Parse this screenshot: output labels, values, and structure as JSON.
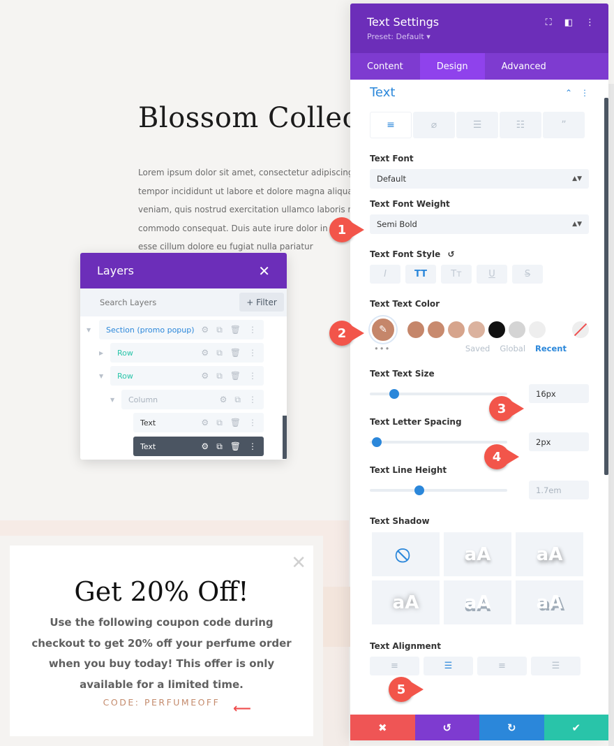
{
  "page": {
    "title": "Blossom Collect",
    "body_lines": [
      "Lorem ipsum dolor sit amet, consectetur adipiscing",
      "tempor incididunt ut labore et dolore magna aliqua",
      "veniam, quis nostrud exercitation ullamco laboris n",
      "commodo consequat. Duis aute irure dolor in",
      "esse cillum dolore eu fugiat nulla pariatur"
    ]
  },
  "layers": {
    "title": "Layers",
    "close_icon": "close-icon",
    "search_placeholder": "Search Layers",
    "filter_label": "+ Filter",
    "items": [
      {
        "label": "Section (promo popup)",
        "type": "section",
        "color": "#2b87da"
      },
      {
        "label": "Row",
        "type": "row",
        "color": "#29c4a9"
      },
      {
        "label": "Row",
        "type": "row",
        "color": "#29c4a9"
      },
      {
        "label": "Column",
        "type": "column",
        "color": "#a8b2bd"
      },
      {
        "label": "Text",
        "type": "module",
        "color": "#333333"
      },
      {
        "label": "Text",
        "type": "module",
        "color": "#ffffff",
        "selected": true
      }
    ]
  },
  "popup": {
    "title": "Get 20% Off!",
    "body": "Use the following coupon code during checkout to get 20% off your perfume order when you buy today! This offer is only available for a limited time.",
    "code": "CODE: PERFUMEOFF",
    "code_color": "#c48b6d"
  },
  "settings": {
    "title": "Text Settings",
    "preset": "Preset: Default ▾",
    "tabs": [
      "Content",
      "Design",
      "Advanced"
    ],
    "active_tab": "Design",
    "section_title": "Text",
    "text_font_label": "Text Font",
    "text_font_value": "Default",
    "font_weight_label": "Text Font Weight",
    "font_weight_value": "Semi Bold",
    "font_style_label": "Text Font Style",
    "font_style_buttons": [
      "I",
      "TT",
      "Tт",
      "U",
      "S"
    ],
    "font_style_active": "TT",
    "text_color_label": "Text Text Color",
    "text_color_value": "#c5866a",
    "swatches": [
      "#c5866a",
      "#c88a6e",
      "#d6a48c",
      "#dbb29e",
      "#111111",
      "#d4d4d4",
      "#eeeeee"
    ],
    "swatch_tabs": [
      "Saved",
      "Global",
      "Recent"
    ],
    "swatch_tab_active": "Recent",
    "more_dots": "•••",
    "text_size_label": "Text Text Size",
    "text_size_value": "16px",
    "text_size_fraction": 0.18,
    "letter_spacing_label": "Text Letter Spacing",
    "letter_spacing_value": "2px",
    "letter_spacing_fraction": 0.05,
    "line_height_label": "Text Line Height",
    "line_height_value": "1.7em",
    "line_height_fraction": 0.36,
    "shadow_label": "Text Shadow",
    "shadow_sample": "aA",
    "alignment_label": "Text Alignment",
    "alignment_active": "center",
    "footer": {
      "cancel_color": "#ef5555",
      "undo_color": "#7e3bd0",
      "redo_color": "#2b87da",
      "save_color": "#29c4a9"
    }
  },
  "callouts": [
    "1",
    "2",
    "3",
    "4",
    "5"
  ]
}
